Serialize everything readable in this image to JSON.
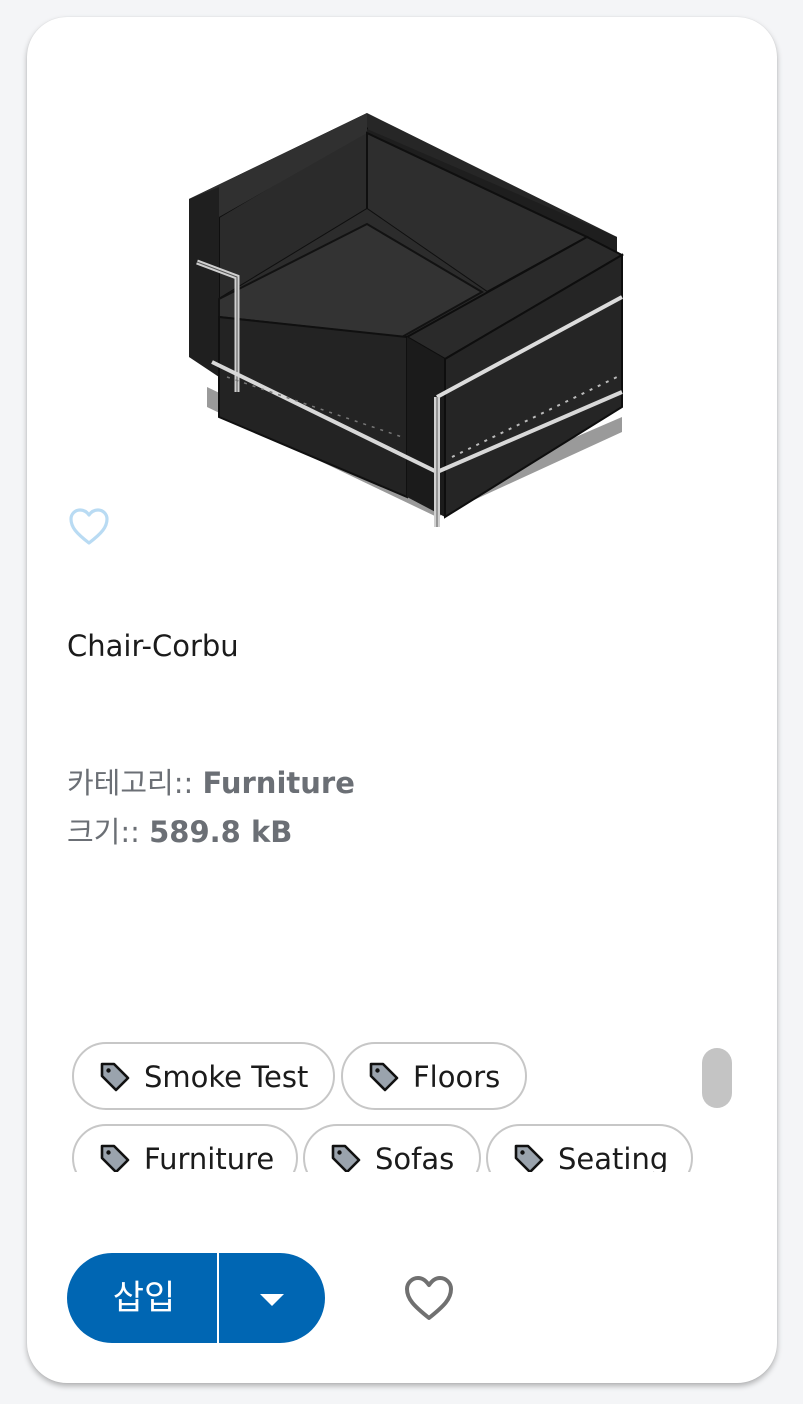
{
  "item": {
    "name": "Chair-Corbu",
    "category_label": "카테고리::",
    "category_value": "Furniture",
    "size_label": "크기::",
    "size_value": "589.8 kB"
  },
  "tags": [
    {
      "label": "Smoke Test",
      "icon": "tag-icon"
    },
    {
      "label": "Floors",
      "icon": "tag-icon"
    },
    {
      "label": "Furniture",
      "icon": "tag-icon"
    },
    {
      "label": "Sofas",
      "icon": "tag-icon"
    },
    {
      "label": "Seating",
      "icon": "tag-icon"
    }
  ],
  "actions": {
    "insert_label": "삽입",
    "dropdown_icon": "caret-down-icon",
    "favorite_icon": "heart-outline-icon"
  },
  "icons": {
    "thumbnail_favorite": "heart-outline-icon"
  },
  "colors": {
    "primary": "#0066b3",
    "muted_text": "#6b6f75",
    "favorite_light": "#b9dbf3",
    "favorite_dark": "#707070"
  }
}
